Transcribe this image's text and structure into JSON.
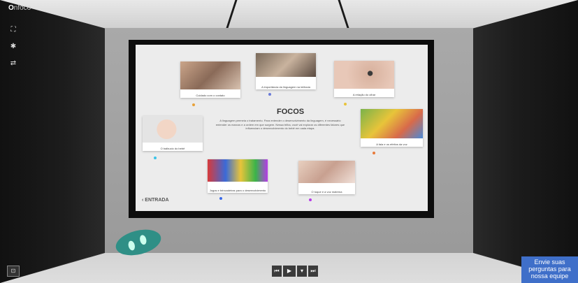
{
  "app": {
    "logo_prefix": "O",
    "logo_text": "nfoco"
  },
  "sidebar": {
    "fullscreen_icon": "⛶",
    "settings_icon": "✱",
    "share_icon": "⇄"
  },
  "slide": {
    "title": "FOCOS",
    "paragraph": "A linguagem permeia o tratamento. Para entender o desenvolvimento da linguagem, é necessário entender os marcos e a ordem em que surgem. Nessa trilha, você vai explorar os diferentes fatores que influenciam o desenvolvimento do bebê em cada etapa.",
    "cards": [
      {
        "caption": "Cuidado com o contato",
        "dot": "#e8a23a"
      },
      {
        "caption": "A importância da linguagem na infância",
        "dot": "#6a7bd8"
      },
      {
        "caption": "A relação do olhar",
        "dot": "#e8c33a"
      },
      {
        "caption": "O balbucio do bebê",
        "dot": "#3ac3e8"
      },
      {
        "caption": "A fala e os efeitos da voz",
        "dot": "#e87a3a"
      },
      {
        "caption": "Jogos e brincadeiras para o desenvolvimento",
        "dot": "#3a6ae8"
      },
      {
        "caption": "O toque e a voz materna",
        "dot": "#b63ae8"
      }
    ],
    "back_label": "ENTRADA",
    "back_icon": "‹"
  },
  "player": {
    "prev_icon": "⏮",
    "play_icon": "▶",
    "down_icon": "▾",
    "next_icon": "⏭"
  },
  "vr_icon": "⊡",
  "ask_button": {
    "line1": "Envie suas",
    "line2": "perguntas para",
    "line3": "nossa equipe"
  }
}
